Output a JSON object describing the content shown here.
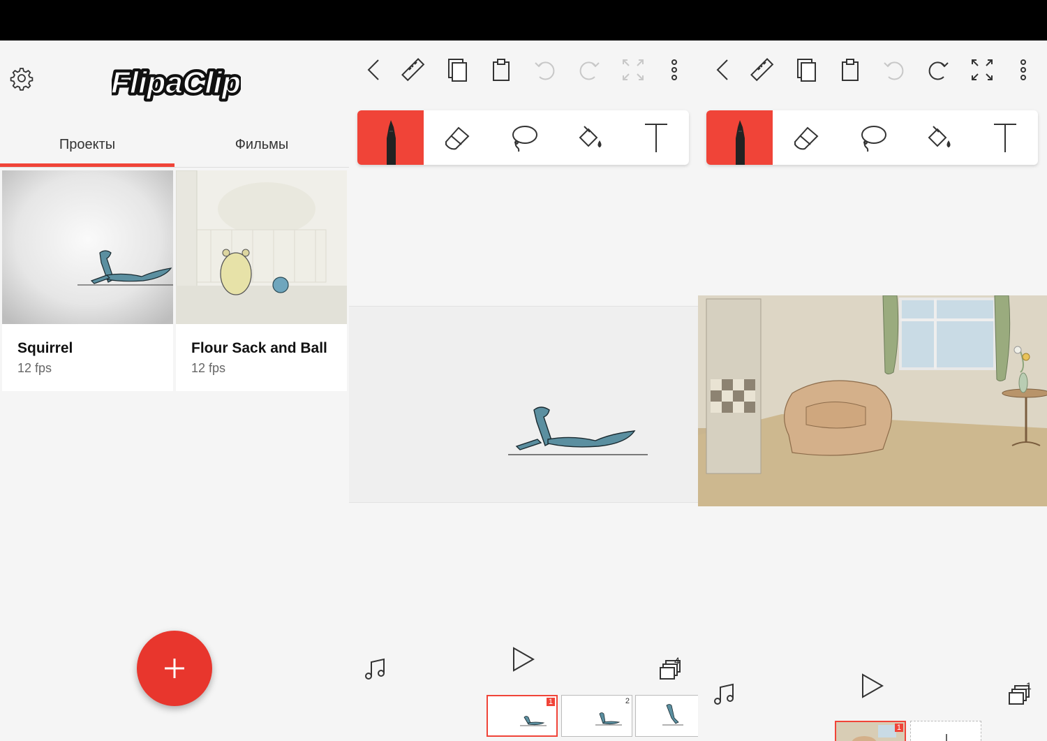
{
  "left_panel": {
    "app_logo_text": "FlipaClip",
    "tabs": [
      "Проекты",
      "Фильмы"
    ],
    "active_tab": 0,
    "projects": [
      {
        "title": "Squirrel",
        "fps": "12 fps"
      },
      {
        "title": "Flour Sack and Ball",
        "fps": "12 fps"
      }
    ],
    "fab_icon": "plus-icon"
  },
  "editor_1": {
    "toolbar_icons": [
      "back-icon",
      "ruler-icon",
      "copy-icon",
      "paste-icon",
      "undo-icon",
      "redo-icon",
      "fullscreen-icon",
      "more-icon"
    ],
    "tools": [
      "pen-icon",
      "eraser-icon",
      "lasso-icon",
      "fill-icon",
      "text-icon"
    ],
    "active_tool": "pen-icon",
    "layers_count": "4",
    "frames": [
      "1",
      "2",
      ""
    ],
    "selected_frame": "1"
  },
  "editor_2": {
    "toolbar_icons": [
      "back-icon",
      "ruler-icon",
      "copy-icon",
      "paste-icon",
      "undo-icon",
      "redo-icon",
      "fullscreen-icon",
      "more-icon"
    ],
    "tools": [
      "pen-icon",
      "eraser-icon",
      "lasso-icon",
      "fill-icon",
      "text-icon"
    ],
    "active_tool": "pen-icon",
    "layers_count": "1",
    "frames": [
      "1"
    ],
    "selected_frame": "1"
  },
  "colors": {
    "accent": "#f04438",
    "fab": "#e8362d",
    "squirrel": "#5b8fa0"
  }
}
